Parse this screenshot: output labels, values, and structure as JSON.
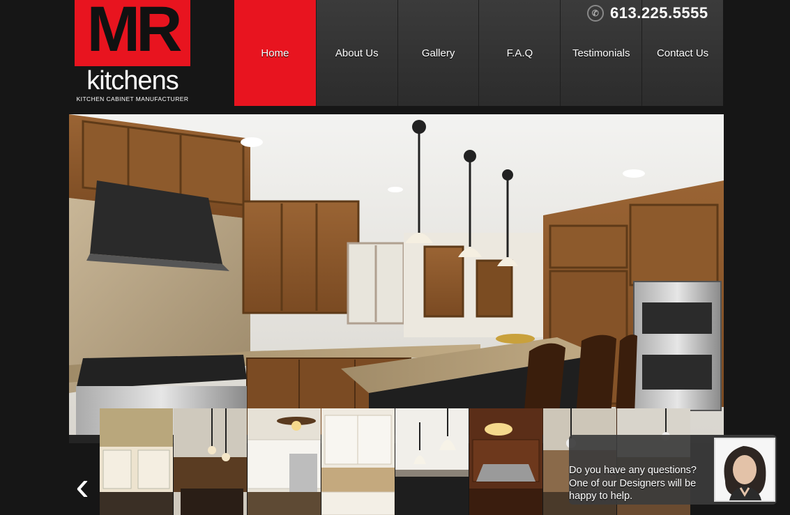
{
  "brand": {
    "logo_letters": "MR",
    "logo_word": "kitchens",
    "tagline": "KITCHEN CABINET MANUFACTURER",
    "accent": "#e8141f"
  },
  "header": {
    "phone": "613.225.5555",
    "phone_icon": "phone-icon"
  },
  "nav": {
    "items": [
      {
        "label": "Home",
        "active": true
      },
      {
        "label": "About Us",
        "active": false
      },
      {
        "label": "Gallery",
        "active": false
      },
      {
        "label": "F.A.Q",
        "active": false
      },
      {
        "label": "Testimonials",
        "active": false
      },
      {
        "label": "Contact Us",
        "active": false
      }
    ]
  },
  "slider": {
    "prev_icon": "chevron-left-icon",
    "prev_glyph": "‹"
  },
  "chat": {
    "line1": "Do you have any questions?",
    "line2": "One of our Designers will be",
    "line3": "happy to help."
  }
}
